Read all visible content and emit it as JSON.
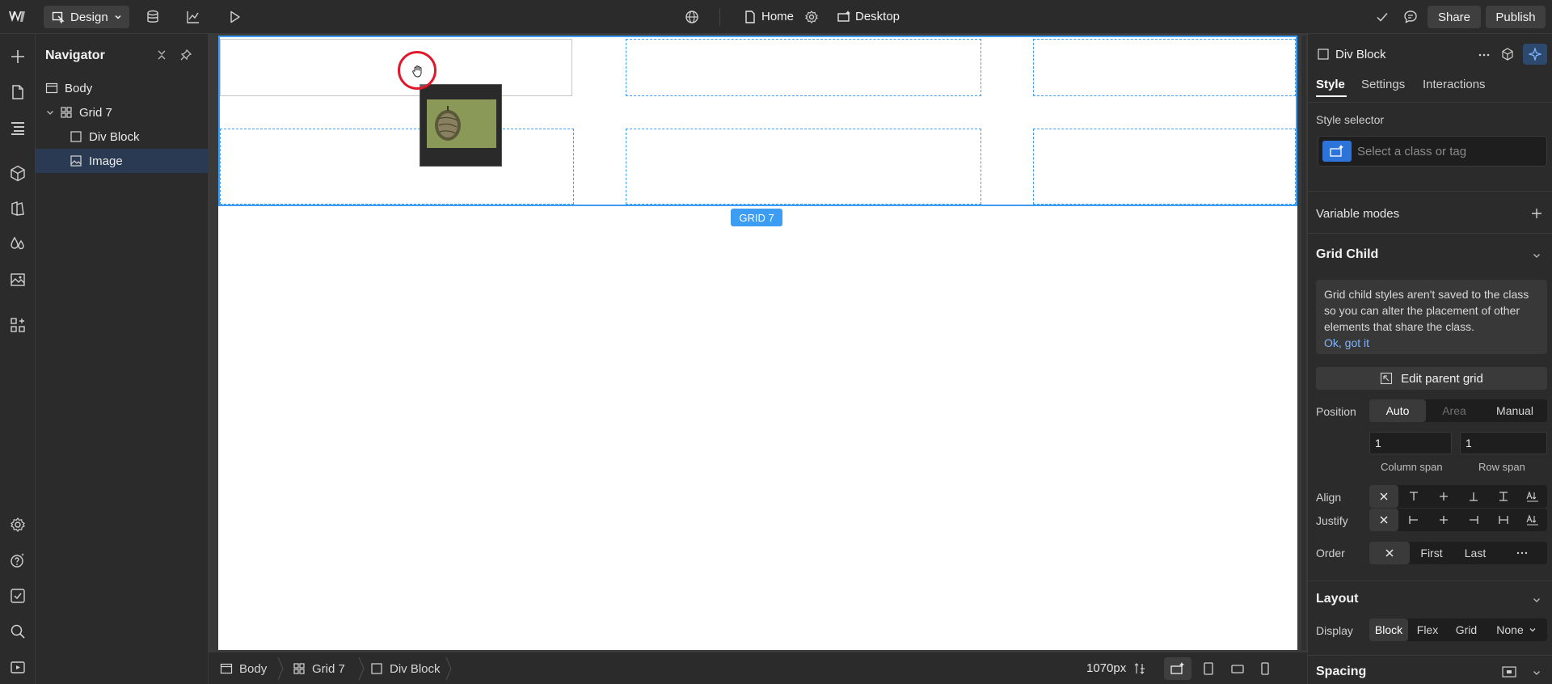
{
  "topbar": {
    "mode_label": "Design",
    "page_name": "Home",
    "breakpoint_name": "Desktop",
    "share_label": "Share",
    "publish_label": "Publish"
  },
  "navigator": {
    "title": "Navigator",
    "items": [
      {
        "label": "Body",
        "icon": "body-box-icon",
        "level": 0,
        "selected": false
      },
      {
        "label": "Grid 7",
        "icon": "grid-icon",
        "level": 0,
        "selected": false,
        "expanded": true
      },
      {
        "label": "Div Block",
        "icon": "div-block-icon",
        "level": 1,
        "selected": false
      },
      {
        "label": "Image",
        "icon": "image-icon",
        "level": 1,
        "selected": true
      }
    ]
  },
  "canvas": {
    "grid_badge": "GRID 7"
  },
  "breadcrumb": {
    "items": [
      {
        "label": "Body"
      },
      {
        "label": "Grid 7"
      },
      {
        "label": "Div Block"
      }
    ],
    "width_label": "1070px"
  },
  "style_panel": {
    "element_name": "Div Block",
    "tabs": [
      "Style",
      "Settings",
      "Interactions"
    ],
    "active_tab": "Style",
    "style_selector_label": "Style selector",
    "style_selector_placeholder": "Select a class or tag",
    "variable_modes_label": "Variable modes",
    "grid_child": {
      "title": "Grid Child",
      "info_text": "Grid child styles aren't saved to the class so you can alter the placement of other elements that share the class.",
      "info_link": "Ok, got it",
      "edit_parent_label": "Edit parent grid",
      "position_label": "Position",
      "position_options": [
        "Auto",
        "Area",
        "Manual"
      ],
      "position_active": "Auto",
      "column_span_value": "1",
      "row_span_value": "1",
      "column_span_label": "Column span",
      "row_span_label": "Row span",
      "align_label": "Align",
      "justify_label": "Justify",
      "order_label": "Order",
      "order_options": [
        "First",
        "Last"
      ]
    },
    "layout": {
      "title": "Layout",
      "display_label": "Display",
      "display_options": [
        "Block",
        "Flex",
        "Grid",
        "None"
      ],
      "display_active": "Block"
    },
    "spacing": {
      "title": "Spacing"
    }
  },
  "colors": {
    "accent_blue": "#3d9df3",
    "selected_row": "#2a3a52",
    "cursor_ring": "#e0182c"
  }
}
